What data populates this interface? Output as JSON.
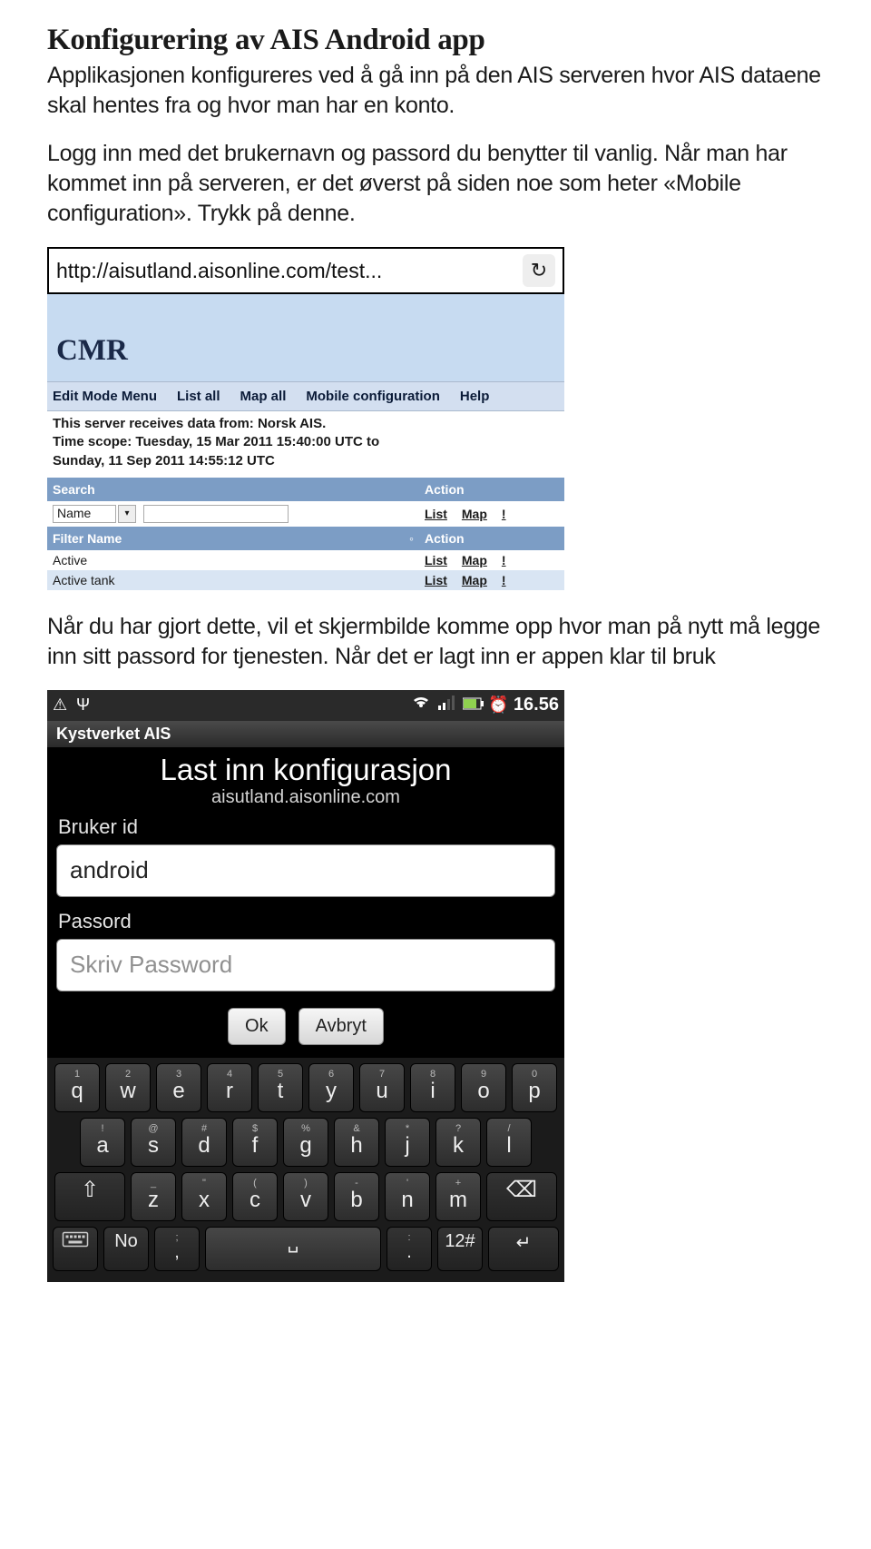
{
  "doc": {
    "heading": "Konfigurering av AIS Android app",
    "p1": "Applikasjonen konfigureres ved å gå inn på den AIS serveren hvor AIS dataene skal hentes fra og hvor man har en konto.",
    "p2": "Logg inn med det brukernavn og passord du benytter til vanlig. Når man har kommet inn på serveren, er det øverst på siden noe som heter «Mobile configuration». Trykk på denne.",
    "p3": "Når du har gjort dette, vil et skjermbilde komme opp hvor man på nytt må legge inn sitt passord for tjenesten. Når det er lagt inn er appen klar til bruk"
  },
  "browser": {
    "url": "http://aisutland.aisonline.com/test...",
    "logo": "CMR",
    "menu": [
      "Edit Mode Menu",
      "List all",
      "Map all",
      "Mobile configuration",
      "Help"
    ],
    "status_line1": "This server receives data from: Norsk AIS.",
    "status_line2": "Time scope: Tuesday, 15 Mar 2011 15:40:00 UTC to",
    "status_line3": "Sunday, 11 Sep 2011 14:55:12 UTC",
    "search_header": "Search",
    "action_header": "Action",
    "name_label": "Name",
    "list_label": "List",
    "map_label": "Map",
    "filter_header": "Filter Name",
    "filters": [
      "Active",
      "Active tank"
    ]
  },
  "phone": {
    "clock": "16.56",
    "app_title": "Kystverket AIS",
    "dialog_title": "Last inn konfigurasjon",
    "dialog_sub": "aisutland.aisonline.com",
    "label_user": "Bruker id",
    "value_user": "android",
    "label_pass": "Passord",
    "placeholder_pass": "Skriv Password",
    "btn_ok": "Ok",
    "btn_cancel": "Avbryt",
    "keys_row1": [
      {
        "s": "1",
        "m": "q"
      },
      {
        "s": "2",
        "m": "w"
      },
      {
        "s": "3",
        "m": "e"
      },
      {
        "s": "4",
        "m": "r"
      },
      {
        "s": "5",
        "m": "t"
      },
      {
        "s": "6",
        "m": "y"
      },
      {
        "s": "7",
        "m": "u"
      },
      {
        "s": "8",
        "m": "i"
      },
      {
        "s": "9",
        "m": "o"
      },
      {
        "s": "0",
        "m": "p"
      }
    ],
    "keys_row2": [
      {
        "s": "!",
        "m": "a"
      },
      {
        "s": "@",
        "m": "s"
      },
      {
        "s": "#",
        "m": "d"
      },
      {
        "s": "$",
        "m": "f"
      },
      {
        "s": "%",
        "m": "g"
      },
      {
        "s": "&",
        "m": "h"
      },
      {
        "s": "*",
        "m": "j"
      },
      {
        "s": "?",
        "m": "k"
      },
      {
        "s": "/",
        "m": "l"
      }
    ],
    "keys_row3": [
      {
        "s": "_",
        "m": "z"
      },
      {
        "s": "\"",
        "m": "x"
      },
      {
        "s": "(",
        "m": "c"
      },
      {
        "s": ")",
        "m": "v"
      },
      {
        "s": "-",
        "m": "b"
      },
      {
        "s": "'",
        "m": "n"
      },
      {
        "s": "+",
        "m": "m"
      }
    ],
    "key_no": "No",
    "key_12": "12#",
    "sym_semicolon": ";",
    "sym_colon": ":",
    "sym_comma": ",",
    "sym_period": "."
  }
}
